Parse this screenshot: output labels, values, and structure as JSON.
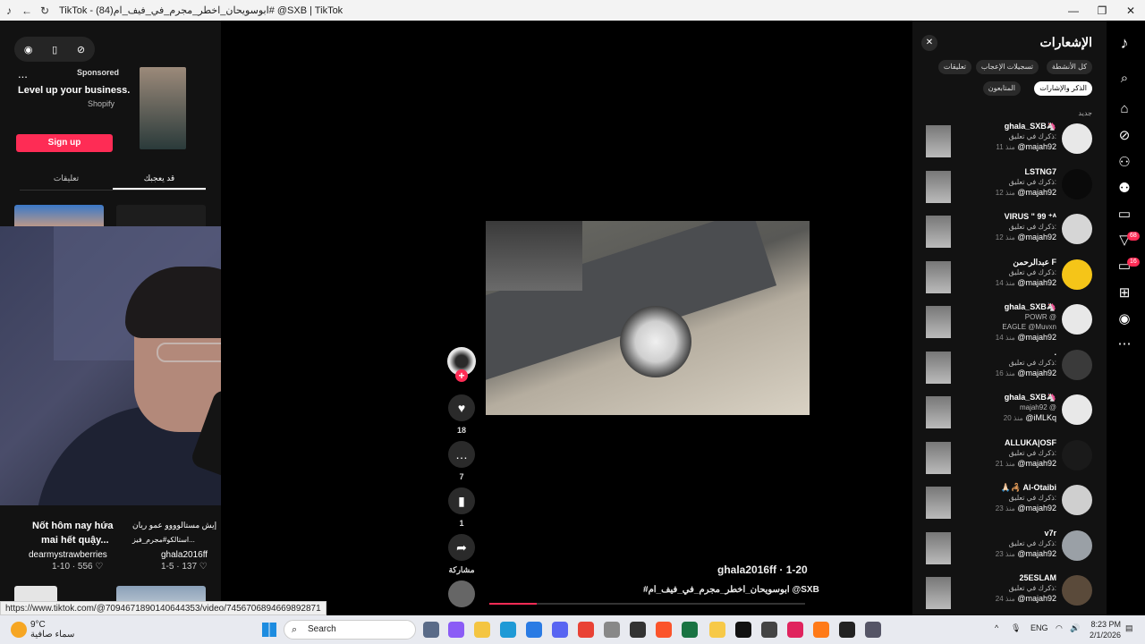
{
  "window": {
    "title": "TikTok - (84)ابوسويحان_اخطر_مجرم_في_فيف_ام# @SXB | TikTok",
    "tiktok_icon": "tiktok-logo-icon",
    "minimize": "—",
    "maximize": "❐",
    "close": "✕"
  },
  "left": {
    "ad": {
      "more": "...",
      "sponsored": "Sponsored",
      "headline": "Level up your business.",
      "brand": "Shopify",
      "cta": "Sign up"
    },
    "tabs": [
      "تعليقات",
      "قد يعجبك"
    ],
    "videos": [
      {
        "caption_line1": "إيش مستالوووو عمو ريان",
        "caption_line2": "استالكو#مجرم_فيز...",
        "author": "ghala2016ff",
        "meta": "1-5 · 137 ♡"
      },
      {
        "caption_line1": "Nốt hôm nay hứa",
        "caption_line2": "mai hết quậy...",
        "author": "dearmystrawberries",
        "meta": "1-10 · 556 ♡"
      }
    ]
  },
  "video": {
    "author_line": "ghala2016ff · 1-20",
    "description": "#ابوسويحان_اخطر_مجرم_في_فيف_ام @SXB",
    "progress": 0.15,
    "likes": "18",
    "comments": "7",
    "saves": "1",
    "share_label": "مشاركة"
  },
  "status_url": "https://www.tiktok.com/@7094671890140644353/video/7456706894669892871",
  "notifications": {
    "title": "الإشعارات",
    "chips_row1": [
      "كل الأنشطة",
      "تسجيلات الإعجاب",
      "تعليقات"
    ],
    "chips_row2": [
      "الذكر والإشارات",
      "المتابعون"
    ],
    "section_new": "جديد",
    "items": [
      {
        "name": "ghala_SXB🦄",
        "line1": "ذكرك في تعليق:",
        "line2": "@majah92",
        "ago": "منذ 11"
      },
      {
        "name": "LSTNG7",
        "line1": "ذكرك في تعليق:",
        "line2": "@majah92",
        "ago": "منذ 12"
      },
      {
        "name": "VIRUS \" 99 ⁺ᴬ",
        "line1": "ذكرك في تعليق:",
        "line2": "@majah92",
        "ago": "منذ 12"
      },
      {
        "name": "عبدالرحمن F",
        "line1": "ذكرك في تعليق:",
        "line2": "@majah92",
        "ago": "منذ 14"
      },
      {
        "name": "ghala_SXB🦄",
        "line1": "POWR @",
        "line1b": "EAGLE @Muvxn",
        "line2": "@majah92",
        "ago": "منذ 14"
      },
      {
        "name": ".",
        "line1": "ذكرك في تعليق:",
        "line2": "@majah92",
        "ago": "منذ 16"
      },
      {
        "name": "ghala_SXB🦄",
        "line1": "majah92 @",
        "line2": "@iMLKq",
        "ago": "منذ 20"
      },
      {
        "name": "ALLUKA|OSF",
        "line1": "ذكرك في تعليق:",
        "line2": "@majah92",
        "ago": "منذ 21"
      },
      {
        "name": "🙏🏻🦂 Al-Otaibi",
        "line1": "ذكرك في تعليق:",
        "line2": "@majah92",
        "ago": "منذ 23"
      },
      {
        "name": "v7r",
        "line1": "ذكرك في تعليق:",
        "line2": "@majah92",
        "ago": "منذ 23"
      },
      {
        "name": "25ESLAM",
        "line1": "ذكرك في تعليق:",
        "line2": "@majah92",
        "ago": "منذ 24"
      }
    ]
  },
  "rail": {
    "badges": [
      "68",
      "16"
    ]
  },
  "taskbar": {
    "temp": "9°C",
    "weather": "سماء صافية",
    "search": "Search",
    "lang": "ENG",
    "time": "8:23 PM",
    "date": "2/1/2026"
  }
}
